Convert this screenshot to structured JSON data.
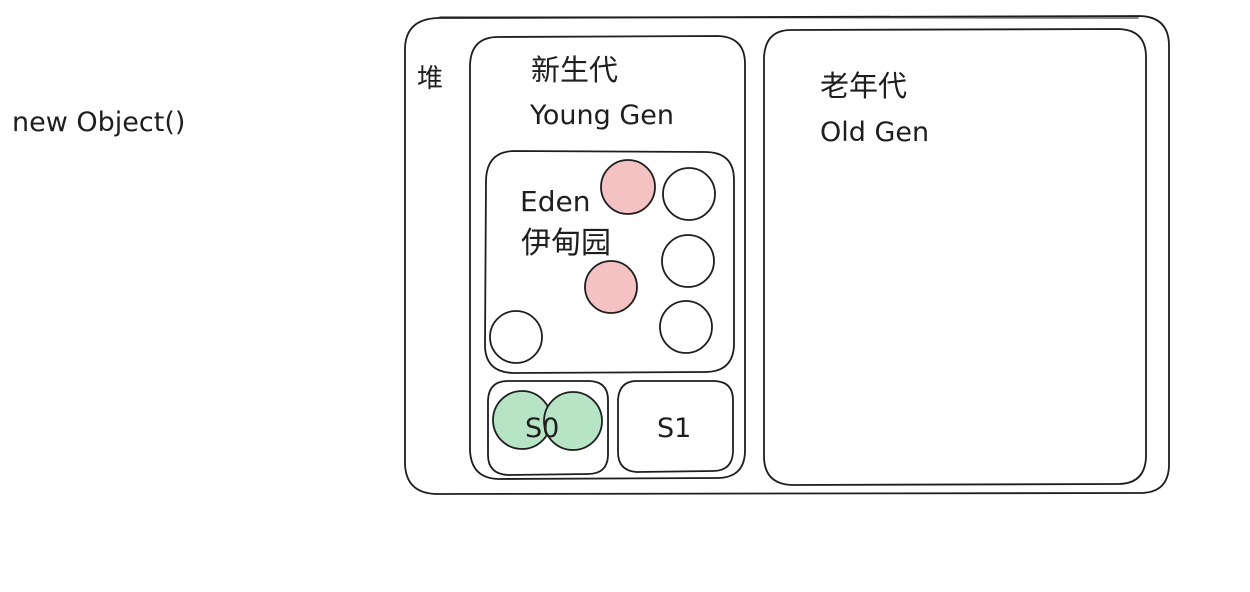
{
  "code_label": "new Object()",
  "heap": {
    "label": "堆",
    "young_gen": {
      "label_cn": "新生代",
      "label_en": "Young Gen",
      "eden": {
        "label_en": "Eden",
        "label_cn": "伊甸园",
        "objects": [
          {
            "state": "live"
          },
          {
            "state": "garbage"
          },
          {
            "state": "live"
          },
          {
            "state": "garbage"
          },
          {
            "state": "live"
          },
          {
            "state": "live"
          }
        ]
      },
      "s0": {
        "label": "S0",
        "objects": [
          {
            "state": "survivor"
          },
          {
            "state": "survivor"
          }
        ]
      },
      "s1": {
        "label": "S1",
        "objects": []
      }
    },
    "old_gen": {
      "label_cn": "老年代",
      "label_en": "Old Gen"
    }
  },
  "colors": {
    "stroke": "#1e1e1e",
    "garbage_fill": "#f4c2c2",
    "survivor_fill": "#b7e4c4",
    "live_fill": "#ffffff"
  }
}
